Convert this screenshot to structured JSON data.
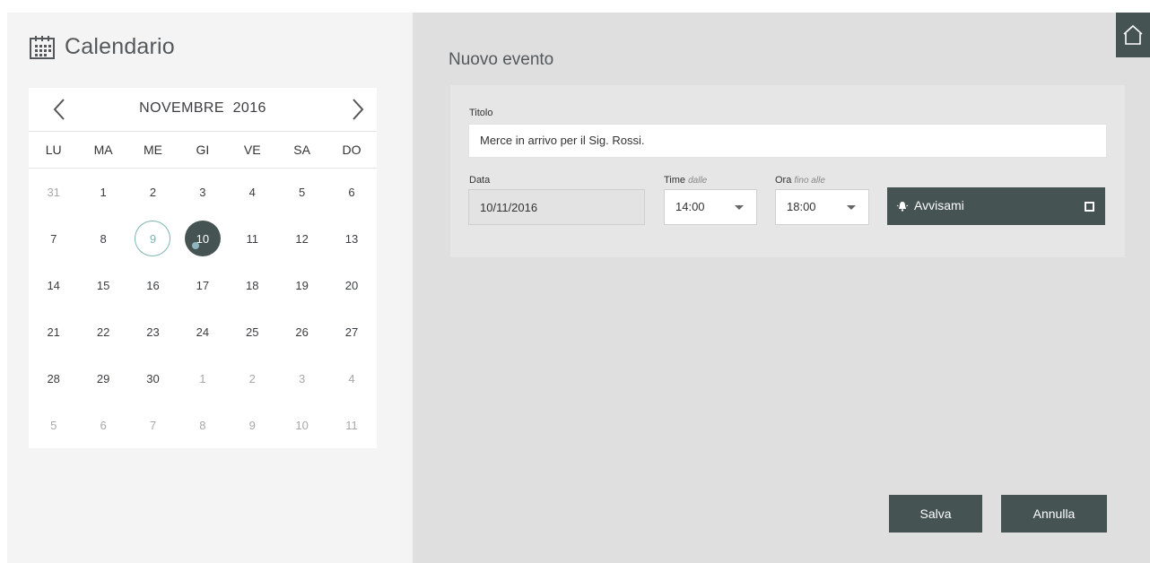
{
  "calendar": {
    "title": "Calendario",
    "month_label": "NOVEMBRE  2016",
    "weekdays": [
      "LU",
      "MA",
      "ME",
      "GI",
      "VE",
      "SA",
      "DO"
    ],
    "weeks": [
      [
        "31",
        "1",
        "2",
        "3",
        "4",
        "5",
        "6"
      ],
      [
        "7",
        "8",
        "9",
        "10",
        "11",
        "12",
        "13"
      ],
      [
        "14",
        "15",
        "16",
        "17",
        "18",
        "19",
        "20"
      ],
      [
        "21",
        "22",
        "23",
        "24",
        "25",
        "26",
        "27"
      ],
      [
        "28",
        "29",
        "30",
        "1",
        "2",
        "3",
        "4"
      ],
      [
        "5",
        "6",
        "7",
        "8",
        "9",
        "10",
        "11"
      ]
    ],
    "today": "9",
    "selected": "10"
  },
  "event_form": {
    "heading": "Nuovo evento",
    "titolo_label": "Titolo",
    "titolo_value": "Merce in arrivo per il Sig. Rossi.",
    "data_label": "Data",
    "data_value": "10/11/2016",
    "time_from_label": "Time",
    "time_from_hint": "dalle",
    "time_from_value": "14:00",
    "time_to_label": "Ora",
    "time_to_hint": "fino alle",
    "time_to_value": "18:00",
    "reminder_label": "Avvisami"
  },
  "actions": {
    "save_label": "Salva",
    "cancel_label": "Annulla"
  },
  "colors": {
    "accent": "#465353",
    "today_ring": "#7fb3b3",
    "event_dot": "#8fb6bf"
  },
  "icons": {
    "calendar": "calendar-icon",
    "prev": "chevron-left-icon",
    "next": "chevron-right-icon",
    "home": "home-icon",
    "bell": "bell-icon",
    "checkbox": "checkbox-icon",
    "dropdown": "chevron-down-icon"
  }
}
